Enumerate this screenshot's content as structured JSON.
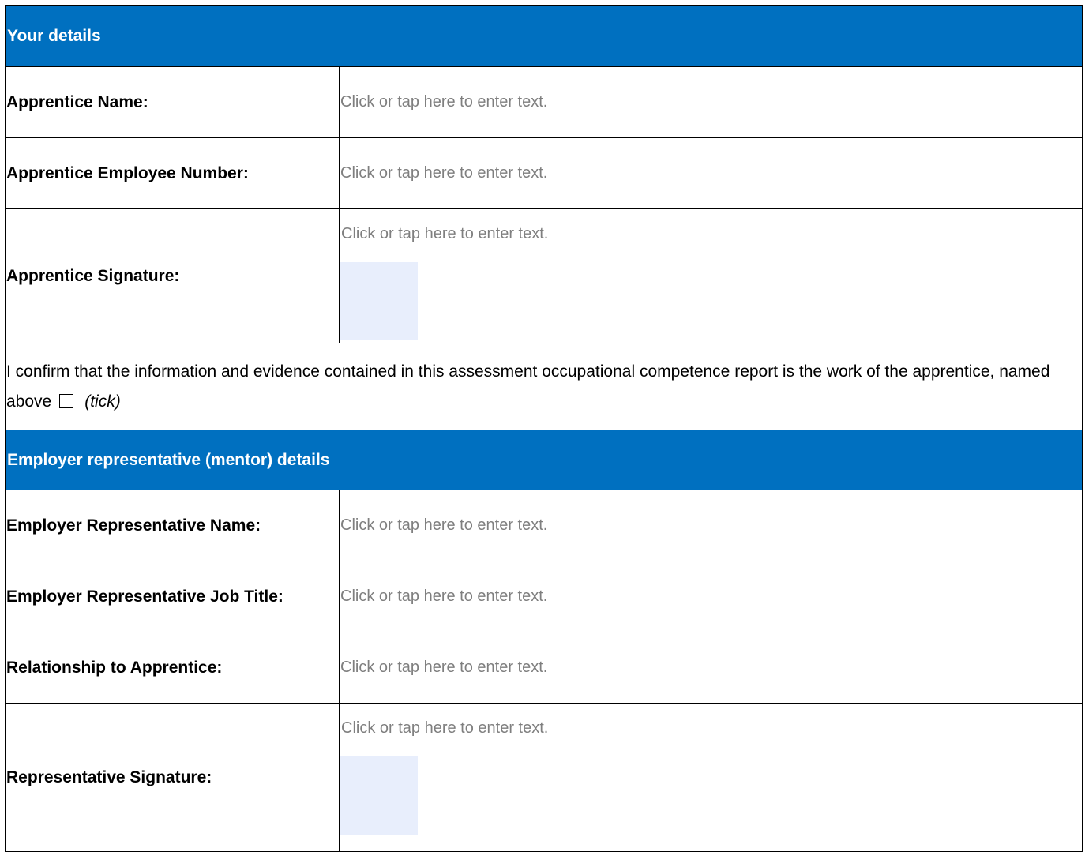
{
  "sections": {
    "your_details": {
      "heading": "Your details",
      "apprentice_name_label": "Apprentice Name:",
      "apprentice_name_value": "Click or tap here to enter text.",
      "employee_number_label": "Apprentice Employee Number:",
      "employee_number_value": "Click or tap here to enter text.",
      "signature_label": "Apprentice Signature:",
      "signature_value": "Click or tap here to enter text."
    },
    "confirmation": {
      "text": "I confirm that the information and evidence contained in this assessment occupational competence report is the work of the apprentice, named above",
      "checkbox_checked": false,
      "tick_note": "(tick)"
    },
    "employer": {
      "heading": "Employer representative (mentor) details",
      "rep_name_label": "Employer Representative Name:",
      "rep_name_value": "Click or tap here to enter text.",
      "job_title_label": "Employer Representative Job Title:",
      "job_title_value": "Click or tap here to enter text.",
      "relationship_label": "Relationship to Apprentice:",
      "relationship_value": "Click or tap here to enter text.",
      "signature_label": "Representative Signature:",
      "signature_value": "Click or tap here to enter text."
    }
  },
  "colors": {
    "header_bg": "#0070c0",
    "header_text": "#ffffff",
    "placeholder_text": "#7f7f7f",
    "signature_box": "#e8eefc"
  }
}
